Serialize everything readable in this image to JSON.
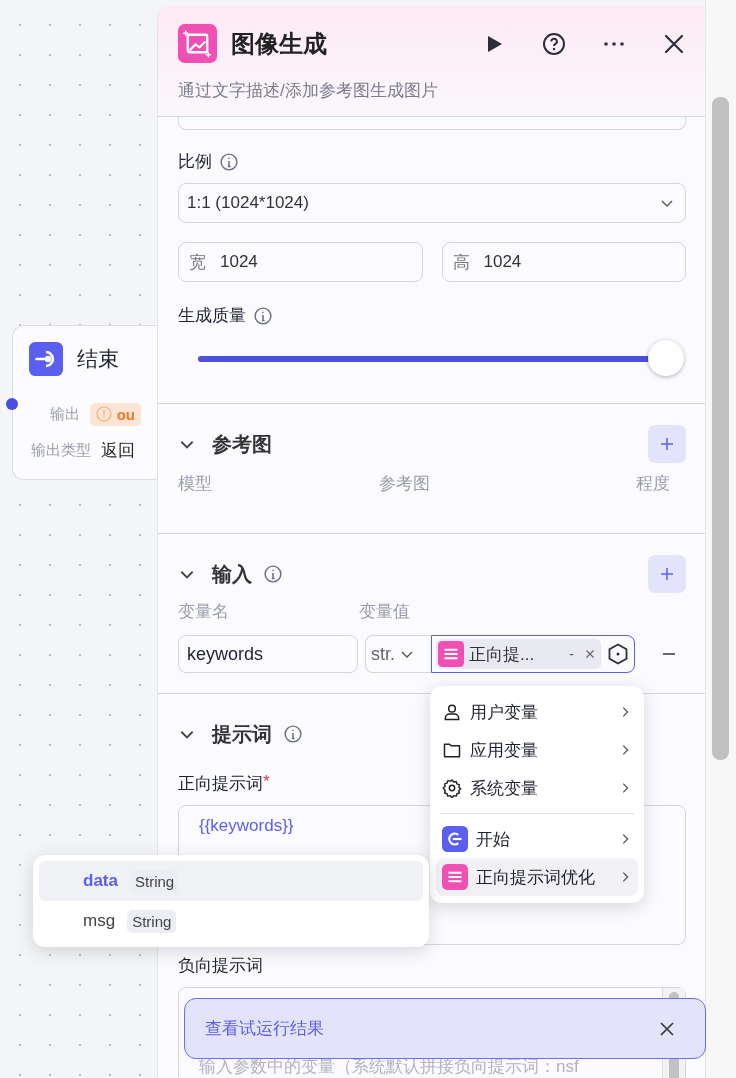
{
  "canvas_node": {
    "title": "结束",
    "fields": [
      {
        "label": "输出",
        "value": "ou",
        "kind": "warning"
      },
      {
        "label": "输出类型",
        "value": "返回",
        "kind": "text"
      }
    ]
  },
  "panel": {
    "title": "图像生成",
    "subtitle": "通过文字描述/添加参考图生成图片",
    "ratio": {
      "label": "比例",
      "value": "1:1 (1024*1024)"
    },
    "size": [
      {
        "label": "宽",
        "value": "1024"
      },
      {
        "label": "高",
        "value": "1024"
      }
    ],
    "quality": {
      "label": "生成质量",
      "level": 1
    },
    "reference": {
      "title": "参考图",
      "expanded": true,
      "columns": [
        "模型",
        "参考图",
        "程度"
      ]
    },
    "inputs": {
      "title": "输入",
      "expanded": true,
      "columns": [
        "变量名",
        "变量值"
      ],
      "rows": [
        {
          "name": "keywords",
          "type": "str.",
          "ref": "正向提...",
          "ref_suffix": "-"
        }
      ]
    },
    "prompt": {
      "title": "提示词",
      "expanded": true,
      "positive_label": "正向提示词",
      "required_mark": "*",
      "positive_value": "{{keywords}}",
      "negative_label": "负向提示词",
      "negative_placeholder": "输入参数中的变量（系统默认拼接负向提示词：nsf"
    }
  },
  "variable_menu": {
    "items": [
      {
        "label": "用户变量",
        "kind": "user",
        "selected": false
      },
      {
        "label": "应用变量",
        "kind": "folder",
        "selected": false
      },
      {
        "label": "系统变量",
        "kind": "gear",
        "selected": false
      },
      {
        "label": "开始",
        "kind": "start",
        "selected": false
      },
      {
        "label": "正向提示词优化",
        "kind": "node",
        "selected": true
      }
    ]
  },
  "output_menu": {
    "items": [
      {
        "name": "data",
        "type": "String",
        "selected": true
      },
      {
        "name": "msg",
        "type": "String",
        "selected": false
      }
    ]
  },
  "toast": {
    "text": "查看试运行结果"
  }
}
